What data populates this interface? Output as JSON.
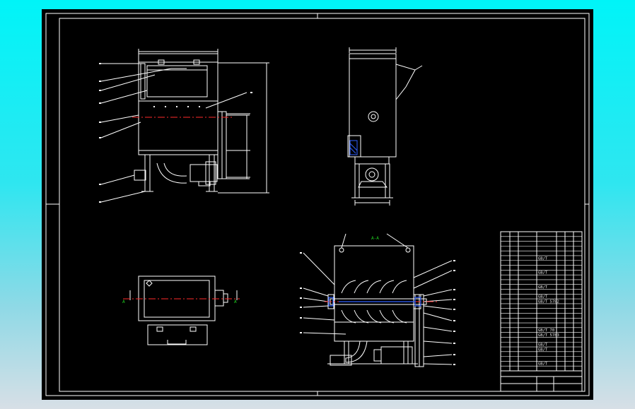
{
  "view_labels": {
    "section_left": "A",
    "section_right": "A",
    "section_title": "A-A"
  },
  "title_block": {
    "rows": [
      "",
      "",
      "",
      "",
      "",
      "GB/T",
      "",
      "",
      "GB/T",
      "",
      "",
      "GB/T",
      "",
      "GB/T",
      "GB/T 5782",
      "",
      "",
      "",
      "",
      "",
      "GB/T 70",
      "GB/T 5783",
      "",
      "GB/T",
      "GB/T",
      "",
      "",
      "GB/T",
      ""
    ],
    "header_cells": [
      "",
      "",
      "",
      "",
      "",
      ""
    ],
    "footer_cells": [
      "",
      "",
      "",
      "",
      "",
      "",
      "",
      ""
    ]
  },
  "colors": {
    "background": "#000000",
    "line": "#ffffff",
    "centerline": "#ff2a2a",
    "section_mark": "#20d020",
    "detail": "#3060ff"
  }
}
